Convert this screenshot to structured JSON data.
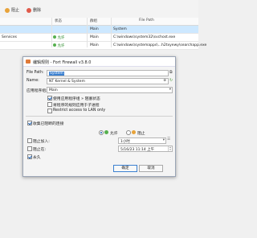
{
  "toolbar": {
    "block_label": "阻止",
    "delete_label": "删除"
  },
  "table": {
    "headers": [
      "状态",
      "群组",
      "File Path"
    ],
    "rows": [
      {
        "name": "",
        "status": "",
        "group": "Main",
        "path": "System",
        "selected": true
      },
      {
        "name": "Services",
        "status": "允许",
        "group": "Main",
        "path": "C:\\windows\\system32\\svchost.exe",
        "selected": false
      },
      {
        "name": "",
        "status": "允许",
        "group": "Main",
        "path": "C:\\windows\\systemapps\\...h2txyewy\\searchapp.exe",
        "selected": false
      }
    ]
  },
  "dialog": {
    "title": "编辑规则 - Fort Firewall v3.8.0",
    "file_path_label": "File Path:",
    "file_path_value": "System",
    "name_label": "Name:",
    "name_value": "NT Kernel & System",
    "app_group_label": "应用程序组:",
    "app_group_value": "Main",
    "opt1": "使用应用程序组 » 阻塞状态",
    "opt2": "将程序的规则应用于子进程",
    "opt3": "Restrict access to LAN only",
    "collect_label": "收集已阻断的连接",
    "allow_label": "允许",
    "block_label": "阻止",
    "block_in_label": "阻止加入:",
    "block_in_value": "1小时",
    "block_at_label": "阻止在:",
    "block_at_value": "5/16/23 11:14 上午",
    "forever_label": "永久",
    "ok_label": "确定",
    "cancel_label": "取消"
  }
}
